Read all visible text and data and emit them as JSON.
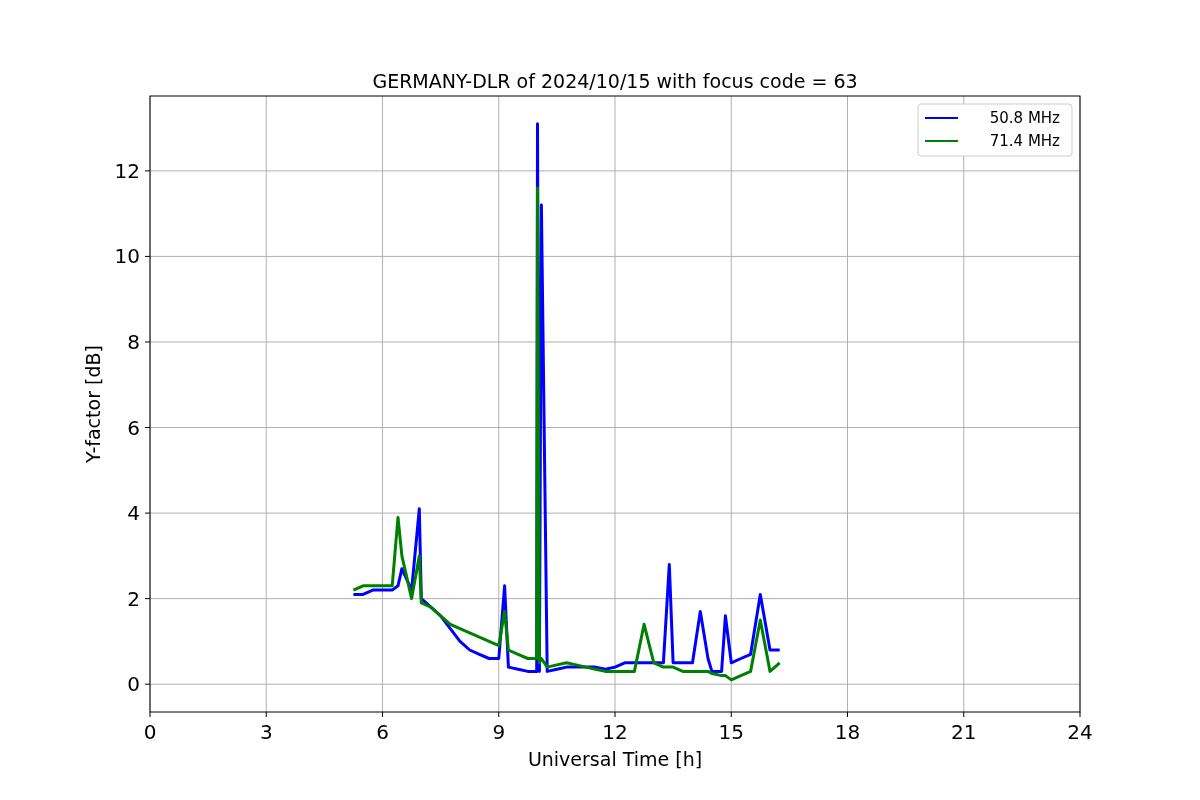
{
  "figure": {
    "chart_data": {
      "type": "line",
      "title": "GERMANY-DLR of 2024/10/15 with focus code = 63",
      "xlabel": "Universal Time [h]",
      "ylabel": "Y-factor [dB]",
      "x": [
        5.25,
        5.5,
        5.75,
        6,
        6.25,
        6.4,
        6.5,
        6.75,
        6.95,
        7,
        7.25,
        7.5,
        7.75,
        8,
        8.25,
        8.5,
        8.75,
        9,
        9.15,
        9.25,
        9.5,
        9.75,
        9.98,
        10.0,
        10.05,
        10.1,
        10.25,
        10.5,
        10.75,
        11,
        11.25,
        11.5,
        11.75,
        12,
        12.25,
        12.5,
        12.75,
        13,
        13.25,
        13.4,
        13.5,
        13.75,
        14,
        14.2,
        14.4,
        14.5,
        14.75,
        14.85,
        15,
        15.25,
        15.5,
        15.75,
        16,
        16.25
      ],
      "series": [
        {
          "name": "50.8 MHz",
          "color": "#0000ff",
          "values": [
            2.1,
            2.1,
            2.2,
            2.2,
            2.2,
            2.3,
            2.7,
            2.2,
            4.1,
            2.0,
            1.8,
            1.6,
            1.3,
            1.0,
            0.8,
            0.7,
            0.6,
            0.6,
            2.3,
            0.4,
            0.35,
            0.3,
            0.3,
            13.1,
            0.3,
            11.2,
            0.3,
            0.35,
            0.4,
            0.4,
            0.4,
            0.4,
            0.35,
            0.4,
            0.5,
            0.5,
            0.5,
            0.5,
            0.5,
            2.8,
            0.5,
            0.5,
            0.5,
            1.7,
            0.6,
            0.3,
            0.3,
            1.6,
            0.5,
            0.6,
            0.7,
            2.1,
            0.8,
            0.8
          ]
        },
        {
          "name": "71.4 MHz",
          "color": "#008000",
          "values": [
            2.2,
            2.3,
            2.3,
            2.3,
            2.3,
            3.9,
            3.0,
            2.0,
            3.0,
            1.9,
            1.8,
            1.6,
            1.4,
            1.3,
            1.2,
            1.1,
            1.0,
            0.9,
            1.7,
            0.8,
            0.7,
            0.6,
            0.6,
            11.6,
            0.5,
            0.6,
            0.4,
            0.45,
            0.5,
            0.45,
            0.4,
            0.35,
            0.3,
            0.3,
            0.3,
            0.3,
            1.4,
            0.5,
            0.4,
            0.4,
            0.4,
            0.3,
            0.3,
            0.3,
            0.3,
            0.25,
            0.2,
            0.2,
            0.1,
            0.2,
            0.3,
            1.5,
            0.3,
            0.5
          ]
        }
      ],
      "xlim": [
        0,
        24
      ],
      "ylim": [
        -0.65,
        13.75
      ],
      "xticks": [
        0,
        3,
        6,
        9,
        12,
        15,
        18,
        21,
        24
      ],
      "yticks": [
        0,
        2,
        4,
        6,
        8,
        10,
        12
      ],
      "grid": true,
      "legend": true
    }
  }
}
